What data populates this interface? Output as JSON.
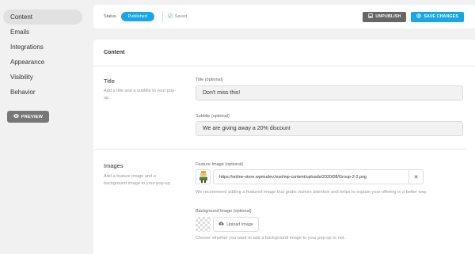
{
  "sidebar": {
    "items": [
      {
        "label": "Content",
        "active": true
      },
      {
        "label": "Emails"
      },
      {
        "label": "Integrations"
      },
      {
        "label": "Appearance"
      },
      {
        "label": "Visibility"
      },
      {
        "label": "Behavior"
      }
    ],
    "preview_label": "PREVIEW"
  },
  "topbar": {
    "status_label": "Status",
    "status_value": "Published",
    "saved_label": "Saved",
    "unpublish_label": "UNPUBLISH",
    "save_label": "SAVE CHANGES"
  },
  "panel": {
    "header": "Content",
    "title_section": {
      "title": "Title",
      "description": "Add a title and a subtitle to your pop-up.",
      "title_label": "Title (optional)",
      "title_value": "Don't miss this!",
      "subtitle_label": "Subtitle (optional)",
      "subtitle_value": "We are giving away a 20% discount"
    },
    "images_section": {
      "title": "Images",
      "description": "Add a feature image and a background image to your pop-up.",
      "feature_label": "Feature Image (optional)",
      "feature_url": "https://online-store.wpmudev.host/wp-content/uploads/2020/08/Group-2-2.png",
      "clear_glyph": "✕",
      "feature_help": "We recommend adding a featured image that grabs visitors attention and helps to explain your offering in a better way.",
      "background_label": "Background Image (optional)",
      "upload_label": "Upload Image",
      "background_help": "Choose whether you want to add a background image to your pop-up or not."
    }
  },
  "colors": {
    "accent": "#17a8e3",
    "unpublish": "#666666",
    "preview": "#777777"
  }
}
